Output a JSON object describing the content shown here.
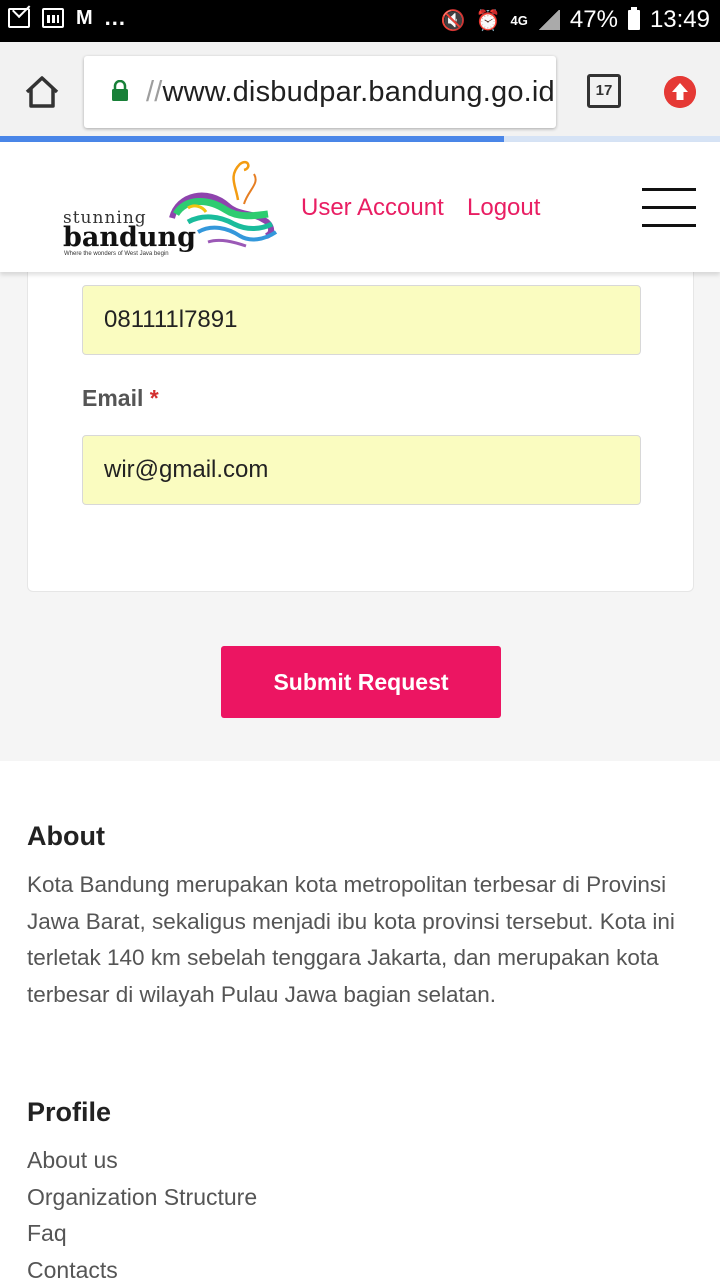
{
  "status_bar": {
    "left_icons": [
      "mail-icon",
      "calendar-icon",
      "gmail-icon"
    ],
    "overflow": "...",
    "network": "4G",
    "battery": "47%",
    "time": "13:49"
  },
  "browser": {
    "url_scheme": "//",
    "url_host": "www.disbudpar.bandung.go.id",
    "tab_count": "17",
    "page_load_progress": 0.7
  },
  "header": {
    "logo_line1": "stunning",
    "logo_line2": "bandung",
    "logo_tagline": "Where the wonders of West Java begin",
    "user_account": "User Account",
    "logout": "Logout"
  },
  "form": {
    "phone_value": "081111l7891",
    "email_label": "Email",
    "required_mark": "*",
    "email_value": "wir@gmail.com",
    "submit_label": "Submit Request"
  },
  "footer": {
    "about_title": "About",
    "about_text": "Kota Bandung merupakan kota metropolitan terbesar di Provinsi Jawa Barat, sekaligus menjadi ibu kota provinsi tersebut. Kota ini terletak 140 km sebelah tenggara Jakarta, dan merupakan kota terbesar di wilayah Pulau Jawa bagian selatan.",
    "profile_title": "Profile",
    "profile_links": [
      "About us",
      "Organization Structure",
      "Faq",
      "Contacts"
    ]
  },
  "colors": {
    "accent": "#ec1562",
    "link": "#e91e63",
    "field_bg": "#fafcc0",
    "lock": "#188038",
    "progress": "#4a86e8"
  }
}
